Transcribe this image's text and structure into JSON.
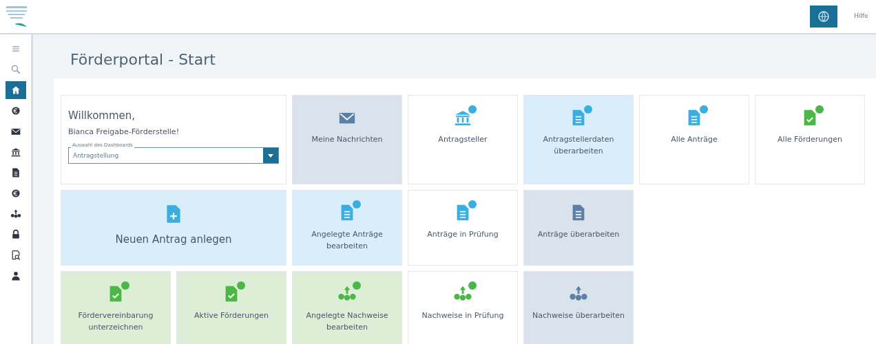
{
  "header": {
    "help_link": "Hilfe"
  },
  "sidebar": {
    "items": [
      {
        "kind": "menu",
        "selected": false
      },
      {
        "kind": "search",
        "selected": false
      },
      {
        "kind": "home",
        "selected": true
      },
      {
        "kind": "euro",
        "selected": false
      },
      {
        "kind": "envelope",
        "selected": false
      },
      {
        "kind": "bank",
        "selected": false
      },
      {
        "kind": "doc",
        "selected": false
      },
      {
        "kind": "euro",
        "selected": false
      },
      {
        "kind": "network",
        "selected": false
      },
      {
        "kind": "lock",
        "selected": false
      },
      {
        "kind": "finder",
        "selected": false
      },
      {
        "kind": "person",
        "selected": false
      }
    ]
  },
  "page_title": "Förderportal - Start",
  "welcome": {
    "greeting": "Willkommen,",
    "name": "Bianca Freigabe-Förderstelle!",
    "dashboard_select": {
      "label": "Auswahl des Dashboards",
      "value": "Antragstellung"
    }
  },
  "tiles": [
    [
      {
        "label": "Meine Nachrichten",
        "kind": "envelope",
        "color": "#dae3ec",
        "dimmed": true,
        "badge": false,
        "wide": false
      },
      {
        "label": "Antragsteller",
        "kind": "bank",
        "color": "#ffffff",
        "dimmed": false,
        "badge": true,
        "wide": false
      },
      {
        "label": "Antragstellerdaten überarbeiten",
        "kind": "doc",
        "color": "#d9eefa",
        "dimmed": false,
        "badge": true,
        "wide": false
      },
      {
        "label": "Alle Anträge",
        "kind": "doc",
        "color": "#ffffff",
        "dimmed": false,
        "badge": true,
        "wide": false
      },
      {
        "label": "Alle Förderungen",
        "kind": "approved",
        "color": "#ffffff",
        "dimmed": false,
        "badge": true,
        "wide": false
      }
    ],
    [
      {
        "label": "Neuen Antrag anlegen",
        "kind": "newdoc",
        "color": "#d9eefa",
        "dimmed": false,
        "badge": false,
        "wide": true
      },
      {
        "label": "Angelegte Anträge bearbeiten",
        "kind": "doc",
        "color": "#d9eefa",
        "dimmed": false,
        "badge": true,
        "wide": false
      },
      {
        "label": "Anträge in Prüfung",
        "kind": "doc",
        "color": "#ffffff",
        "dimmed": false,
        "badge": true,
        "wide": false
      },
      {
        "label": "Anträge überarbeiten",
        "kind": "doc",
        "color": "#dae3ec",
        "dimmed": true,
        "badge": false,
        "wide": false
      }
    ],
    [
      {
        "label": "Fördervereinbarung unterzeichnen",
        "kind": "approved",
        "color": "#dcefd6",
        "dimmed": false,
        "badge": true,
        "wide": false
      },
      {
        "label": "Aktive Förderungen",
        "kind": "approved",
        "color": "#dcefd6",
        "dimmed": false,
        "badge": true,
        "wide": false
      },
      {
        "label": "Angelegte Nachweise bearbeiten",
        "kind": "network",
        "color": "#dcefd6",
        "dimmed": false,
        "badge": true,
        "wide": false
      },
      {
        "label": "Nachweise in Prüfung",
        "kind": "network",
        "color": "#ffffff",
        "dimmed": false,
        "badge": true,
        "wide": false
      },
      {
        "label": "Nachweise überarbeiten",
        "kind": "network",
        "color": "#dae3ec",
        "dimmed": true,
        "badge": false,
        "wide": false
      }
    ]
  ]
}
